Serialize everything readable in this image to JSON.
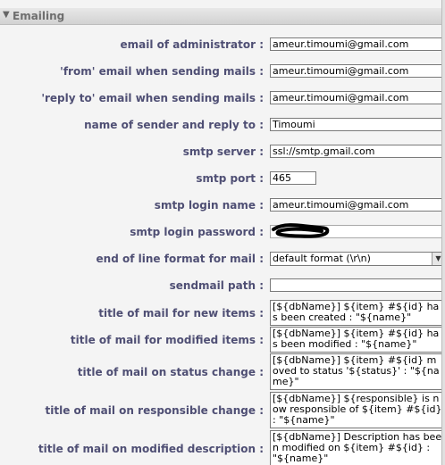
{
  "section": {
    "title": "Emailing"
  },
  "fields": {
    "admin_email": {
      "label": "email of administrator :",
      "value": "ameur.timoumi@gmail.com"
    },
    "from_email": {
      "label": "'from' email when sending mails :",
      "value": "ameur.timoumi@gmail.com"
    },
    "reply_to_email": {
      "label": "'reply to' email when sending mails :",
      "value": "ameur.timoumi@gmail.com"
    },
    "sender_name": {
      "label": "name of sender and reply to :",
      "value": "Timoumi"
    },
    "smtp_server": {
      "label": "smtp server :",
      "value": "ssl://smtp.gmail.com"
    },
    "smtp_port": {
      "label": "smtp port :",
      "value": "465"
    },
    "smtp_login": {
      "label": "smtp login name :",
      "value": "ameur.timoumi@gmail.com"
    },
    "smtp_password": {
      "label": "smtp login password :"
    },
    "eol_format": {
      "label": "end of line format for mail :",
      "value": "default format (\\r\\n)"
    },
    "sendmail_path": {
      "label": "sendmail path :",
      "value": ""
    },
    "title_new_items": {
      "label": "title of mail for new items :",
      "value": "[${dbName}] ${item} #${id} has been created : \"${name}\""
    },
    "title_modified_items": {
      "label": "title of mail for modified items :",
      "value": "[${dbName}] ${item} #${id} has been modified : \"${name}\""
    },
    "title_status_change": {
      "label": "title of mail on status change :",
      "value": "[${dbName}] ${item} #${id} moved to status '${status}' : \"${name}\""
    },
    "title_responsible_change": {
      "label": "title of mail on responsible change :",
      "value": "[${dbName}] ${responsible} is now responsible of ${item} #${id} : \"${name}\""
    },
    "title_modified_description": {
      "label": "title of mail on modified description :",
      "value": "[${dbName}] Description has been modified on ${item} #${id} : \"${name}\""
    }
  }
}
